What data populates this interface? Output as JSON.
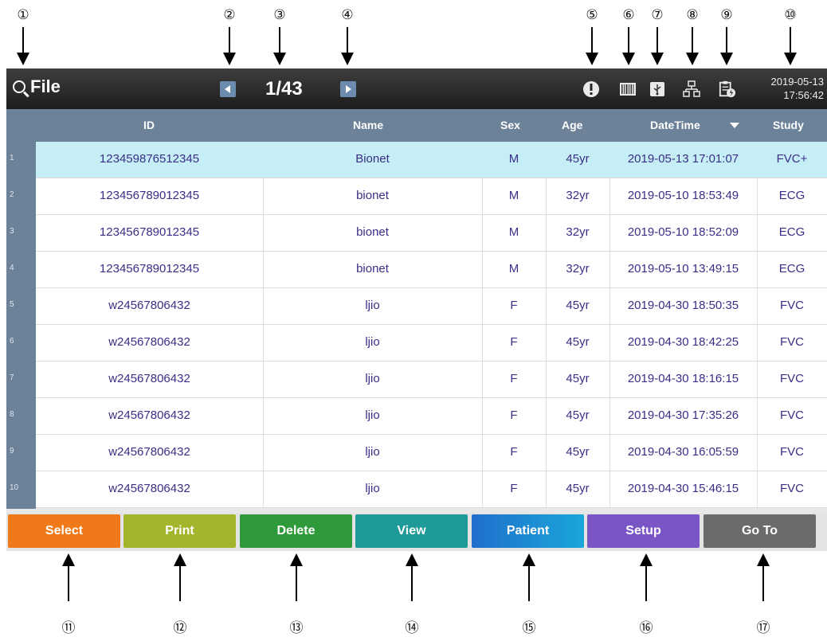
{
  "callouts": {
    "top": [
      "①",
      "②",
      "③",
      "④",
      "⑤",
      "⑥",
      "⑦",
      "⑧",
      "⑨",
      "⑩"
    ],
    "bottom": [
      "⑪",
      "⑫",
      "⑬",
      "⑭",
      "⑮",
      "⑯",
      "⑰"
    ]
  },
  "header": {
    "title": "File",
    "page": "1/43",
    "date": "2019-05-13",
    "time": "17:56:42"
  },
  "status_icons": [
    "alert-icon",
    "barcode-icon",
    "usb-icon",
    "network-icon",
    "clipboard-battery-icon"
  ],
  "table": {
    "columns": [
      "ID",
      "Name",
      "Sex",
      "Age",
      "DateTime",
      "Study"
    ],
    "sort_column": "DateTime",
    "selected_row": 1,
    "rows": [
      {
        "n": "1",
        "id": "123459876512345",
        "name": "Bionet",
        "sex": "M",
        "age": "45yr",
        "datetime": "2019-05-13 17:01:07",
        "study": "FVC+"
      },
      {
        "n": "2",
        "id": "123456789012345",
        "name": "bionet",
        "sex": "M",
        "age": "32yr",
        "datetime": "2019-05-10 18:53:49",
        "study": "ECG"
      },
      {
        "n": "3",
        "id": "123456789012345",
        "name": "bionet",
        "sex": "M",
        "age": "32yr",
        "datetime": "2019-05-10 18:52:09",
        "study": "ECG"
      },
      {
        "n": "4",
        "id": "123456789012345",
        "name": "bionet",
        "sex": "M",
        "age": "32yr",
        "datetime": "2019-05-10 13:49:15",
        "study": "ECG"
      },
      {
        "n": "5",
        "id": "w24567806432",
        "name": "ljio",
        "sex": "F",
        "age": "45yr",
        "datetime": "2019-04-30 18:50:35",
        "study": "FVC"
      },
      {
        "n": "6",
        "id": "w24567806432",
        "name": "ljio",
        "sex": "F",
        "age": "45yr",
        "datetime": "2019-04-30 18:42:25",
        "study": "FVC"
      },
      {
        "n": "7",
        "id": "w24567806432",
        "name": "ljio",
        "sex": "F",
        "age": "45yr",
        "datetime": "2019-04-30 18:16:15",
        "study": "FVC"
      },
      {
        "n": "8",
        "id": "w24567806432",
        "name": "ljio",
        "sex": "F",
        "age": "45yr",
        "datetime": "2019-04-30 17:35:26",
        "study": "FVC"
      },
      {
        "n": "9",
        "id": "w24567806432",
        "name": "ljio",
        "sex": "F",
        "age": "45yr",
        "datetime": "2019-04-30 16:05:59",
        "study": "FVC"
      },
      {
        "n": "10",
        "id": "w24567806432",
        "name": "ljio",
        "sex": "F",
        "age": "45yr",
        "datetime": "2019-04-30 15:46:15",
        "study": "FVC"
      }
    ]
  },
  "buttons": [
    {
      "label": "Select",
      "color": "#f07a1a"
    },
    {
      "label": "Print",
      "color": "#a3b52a"
    },
    {
      "label": "Delete",
      "color": "#2e9a3a"
    },
    {
      "label": "View",
      "color": "#1e9a98"
    },
    {
      "label": "Patient",
      "color": "#1f80cc"
    },
    {
      "label": "Setup",
      "color": "#7a55c6"
    },
    {
      "label": "Go To",
      "color": "#6b6b6b"
    }
  ]
}
